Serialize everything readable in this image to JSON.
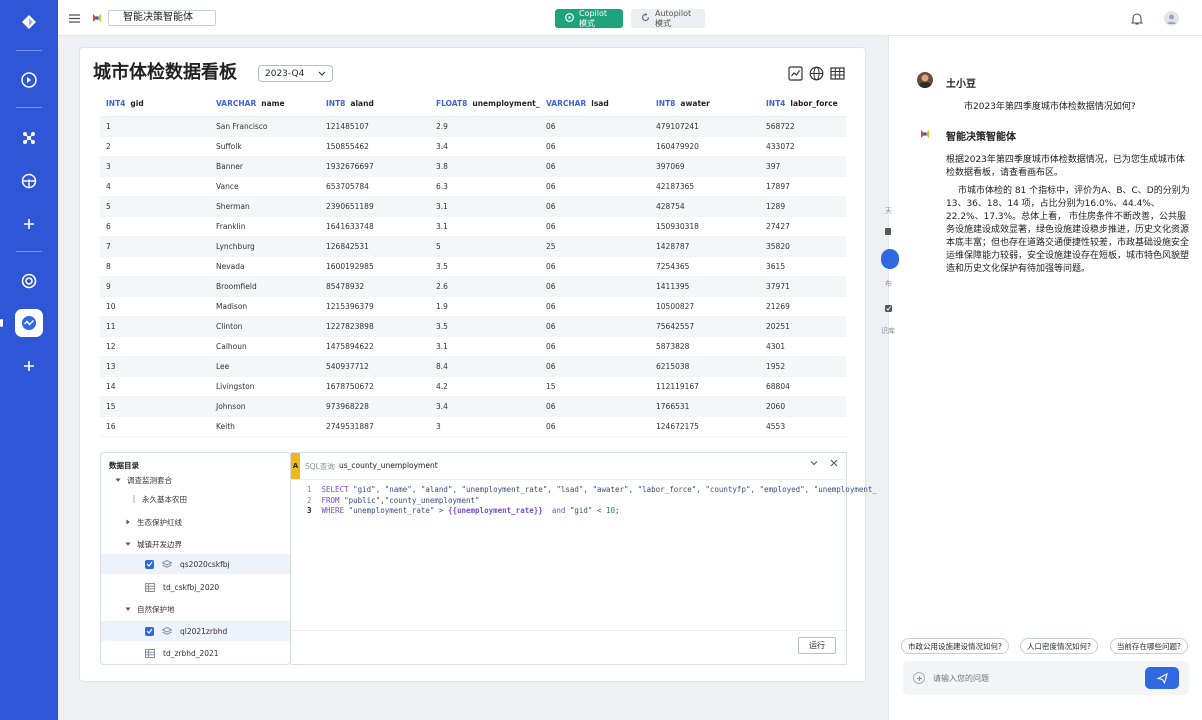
{
  "app": {
    "title": "智能决策智能体",
    "copilot_label": "Copilot模式",
    "autopilot_label": "Autopilot模式"
  },
  "colors": {
    "brand": "#2f56d6",
    "copilot": "#1fa37d",
    "accent": "#2f68e0",
    "sql_tag": "#f0b81c"
  },
  "dashboard": {
    "title": "城市体检数据看板",
    "period": "2023-Q4",
    "icons": [
      "chart-icon",
      "globe-icon",
      "table-icon"
    ]
  },
  "table": {
    "columns": [
      {
        "type": "INT4",
        "name": "gid"
      },
      {
        "type": "VARCHAR",
        "name": "name"
      },
      {
        "type": "INT8",
        "name": "aland"
      },
      {
        "type": "FLOAT8",
        "name": "unemployment_rate"
      },
      {
        "type": "VARCHAR",
        "name": "lsad"
      },
      {
        "type": "INT8",
        "name": "awater"
      },
      {
        "type": "INT4",
        "name": "labor_force"
      }
    ],
    "rows": [
      [
        "1",
        "San Francisco",
        "121485107",
        "2.9",
        "06",
        "479107241",
        "568722"
      ],
      [
        "2",
        "Suffolk",
        "150855462",
        "3.4",
        "06",
        "160479920",
        "433072"
      ],
      [
        "3",
        "Banner",
        "1932676697",
        "3.8",
        "06",
        "397069",
        "397"
      ],
      [
        "4",
        "Vance",
        "653705784",
        "6.3",
        "06",
        "42187365",
        "17897"
      ],
      [
        "5",
        "Sherman",
        "2390651189",
        "3.1",
        "06",
        "428754",
        "1289"
      ],
      [
        "6",
        "Franklin",
        "1641633748",
        "3.1",
        "06",
        "150930318",
        "27427"
      ],
      [
        "7",
        "Lynchburg",
        "126842531",
        "5",
        "25",
        "1428787",
        "35820"
      ],
      [
        "8",
        "Nevada",
        "1600192985",
        "3.5",
        "06",
        "7254365",
        "3615"
      ],
      [
        "9",
        "Broomfield",
        "85478932",
        "2.6",
        "06",
        "1411395",
        "37971"
      ],
      [
        "10",
        "Madison",
        "1215396379",
        "1.9",
        "06",
        "10500827",
        "21269"
      ],
      [
        "11",
        "Clinton",
        "1227823898",
        "3.5",
        "06",
        "75642557",
        "20251"
      ],
      [
        "12",
        "Calhoun",
        "1475894622",
        "3.1",
        "06",
        "5873828",
        "4301"
      ],
      [
        "13",
        "Lee",
        "540937712",
        "8.4",
        "06",
        "6215038",
        "1952"
      ],
      [
        "14",
        "Livingston",
        "1678750672",
        "4.2",
        "15",
        "112119167",
        "68804"
      ],
      [
        "15",
        "Johnson",
        "973968228",
        "3.4",
        "06",
        "1766531",
        "2060"
      ],
      [
        "16",
        "Keith",
        "2749531887",
        "3",
        "06",
        "124672175",
        "4553"
      ]
    ]
  },
  "catalog": {
    "title": "数据目录",
    "items": [
      {
        "label": "调查监测套合",
        "kind": "folder-open"
      },
      {
        "label": "永久基本农田",
        "kind": "leaf"
      },
      {
        "label": "生态保护红线",
        "kind": "folder"
      },
      {
        "label": "城镇开发边界",
        "kind": "folder-open"
      },
      {
        "label": "qs2020cskfbj",
        "kind": "layer-checked"
      },
      {
        "label": "td_cskfbj_2020",
        "kind": "table"
      },
      {
        "label": "自然保护地",
        "kind": "folder-open"
      },
      {
        "label": "ql2021zrbhd",
        "kind": "layer-checked"
      },
      {
        "label": "td_zrbhd_2021",
        "kind": "table"
      }
    ]
  },
  "sql": {
    "tag": "A",
    "label": "SQL查询",
    "name": "us_county_unemployment",
    "line_numbers": [
      "1",
      "2",
      "3"
    ],
    "select_kw": "SELECT",
    "select_cols": "\"gid\", \"name\", \"aland\", \"unemployment_rate\", \"lsad\", \"awater\", \"labor_force\", \"countyfp\", \"employed\", \"unemployment_",
    "from_kw": "FROM",
    "from_tbl": "\"public\",\"county_unemployment\"",
    "where_kw": "WHERE",
    "where_col": "\"unemployment_rate\" > ",
    "where_var": "{{unemployment_rate}}",
    "and_kw": "and",
    "and_col": "\"gid\" < ",
    "and_num": "10",
    "end": ";",
    "run_label": "运行"
  },
  "chat": {
    "user_name": "土小豆",
    "user_message": "市2023年第四季度城市体检数据情况如何?",
    "bot_name": "智能决策智能体",
    "bot_intro": "根据2023年第四季度城市体检数据情况，已为您生成城市体检数据看板，请查看画布区。",
    "bot_detail": "市城市体检的 81 个指标中，评价为A、B、C、D的分别为 13、36、18、14 项，占比分别为16.0%、44.4%、22.2%、17.3%。总体上看， 市住房条件不断改善，公共服务设施建设成效显著，绿色设施建设稳步推进，历史文化资源本底丰富；但也存在道路交通便捷性较差，市政基础设施安全运维保障能力较弱，安全设施建设存在短板，城市特色风貌塑造和历史文化保护有待加强等问题。",
    "side_labels": [
      "天",
      "布",
      "识库"
    ],
    "suggestions": [
      "市政公用设施建设情况如何?",
      "人口密度情况如何?",
      "当前存在哪些问题?"
    ],
    "input_placeholder": "请输入您的问题"
  }
}
